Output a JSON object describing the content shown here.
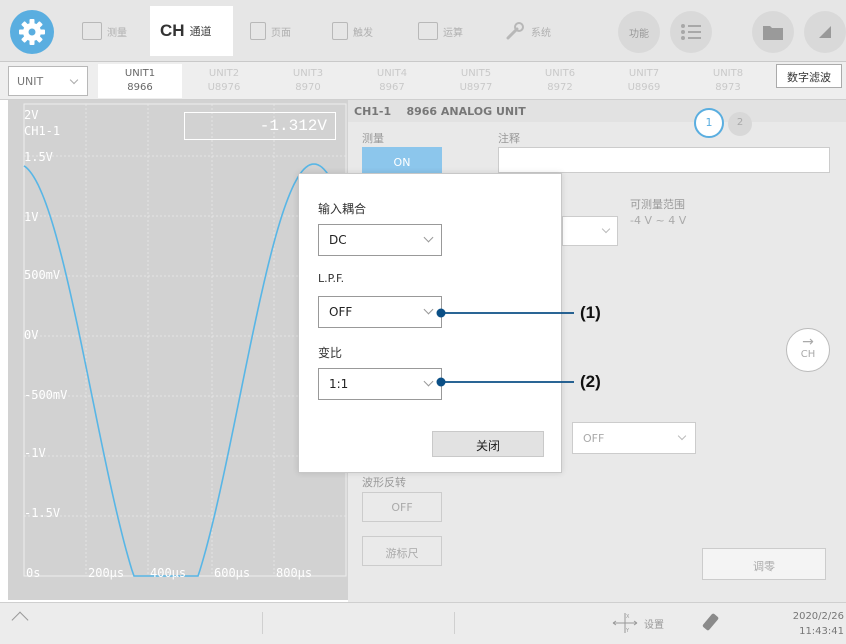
{
  "toolbar": {
    "tabs": [
      {
        "label": "测量"
      },
      {
        "big": "CH",
        "label": "通道"
      },
      {
        "label": "页面"
      },
      {
        "label": "触发"
      },
      {
        "label": "运算"
      },
      {
        "label": "系统"
      }
    ],
    "function_label": "功能"
  },
  "unit_bar": {
    "select_value": "UNIT",
    "tabs": [
      {
        "line1": "UNIT1",
        "line2": "8966"
      },
      {
        "line1": "UNIT2",
        "line2": "U8976"
      },
      {
        "line1": "UNIT3",
        "line2": "8970"
      },
      {
        "line1": "UNIT4",
        "line2": "8967"
      },
      {
        "line1": "UNIT5",
        "line2": "U8977"
      },
      {
        "line1": "UNIT6",
        "line2": "8972"
      },
      {
        "line1": "UNIT7",
        "line2": "U8969"
      },
      {
        "line1": "UNIT8",
        "line2": "8973"
      }
    ],
    "digital_filter_label": "数字滤波"
  },
  "graph": {
    "value_readout": "-1.312V",
    "y_labels": [
      "2V",
      "CH1-1",
      "1.5V",
      "1V",
      "500mV",
      "0V",
      "-500mV",
      "-1V",
      "-1.5V"
    ],
    "x_labels": [
      "0s",
      "200µs",
      "400µs",
      "600µs",
      "800µs"
    ]
  },
  "panel": {
    "title": "CH1-1    8966 ANALOG UNIT",
    "page1": "1",
    "page2": "2",
    "measure_label": "测量",
    "measure_value": "ON",
    "comment_label": "注释",
    "range_label": "可测量范围",
    "range_value": "-4 V ~ 4 V",
    "off_select_value": "OFF",
    "invert_label": "波形反转",
    "invert_value": "OFF",
    "cursor_label": "游标尺",
    "zero_adjust_label": "调零",
    "next_ch_label": "CH"
  },
  "dialog": {
    "coupling_label": "输入耦合",
    "coupling_value": "DC",
    "lpf_label": "L.P.F.",
    "lpf_value": "OFF",
    "ratio_label": "变比",
    "ratio_value": "1:1",
    "close_label": "关闭"
  },
  "callouts": {
    "one": "(1)",
    "two": "(2)"
  },
  "status_bar": {
    "settings_label": "设置",
    "date": "2020/2/26",
    "time": "11:43:41"
  },
  "colors": {
    "accent": "#5aaee0",
    "waveform": "#58b6e6",
    "callout_line": "#0b4f86"
  }
}
